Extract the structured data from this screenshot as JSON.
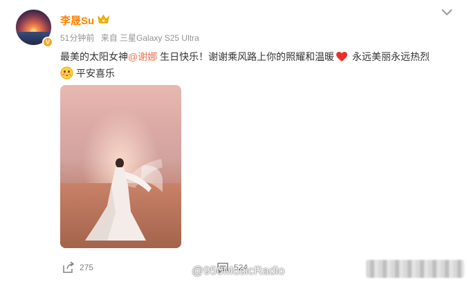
{
  "post": {
    "author": "李晟Su",
    "time": "51分钟前",
    "source": "来自 三星Galaxy S25 Ultra",
    "text_before_mention": "最美的太阳女神",
    "mention": "@谢娜",
    "text_after_mention": " 生日快乐！谢谢乘风路上你的照耀和温暖",
    "text_after_heart": " 永远美丽永远热烈",
    "line2": "平安喜乐"
  },
  "actions": {
    "share_count": "275",
    "comment_count": "524"
  },
  "watermark": "@950MusicRadio",
  "icons": [
    "crown-icon",
    "more-icon",
    "heart-icon",
    "emoji-icon",
    "share-icon",
    "comment-icon",
    "weibo-logo-icon"
  ],
  "colors": {
    "username": "#ff8200",
    "mention": "#eb7350",
    "meta": "#939393",
    "heart": "#e7322c"
  }
}
